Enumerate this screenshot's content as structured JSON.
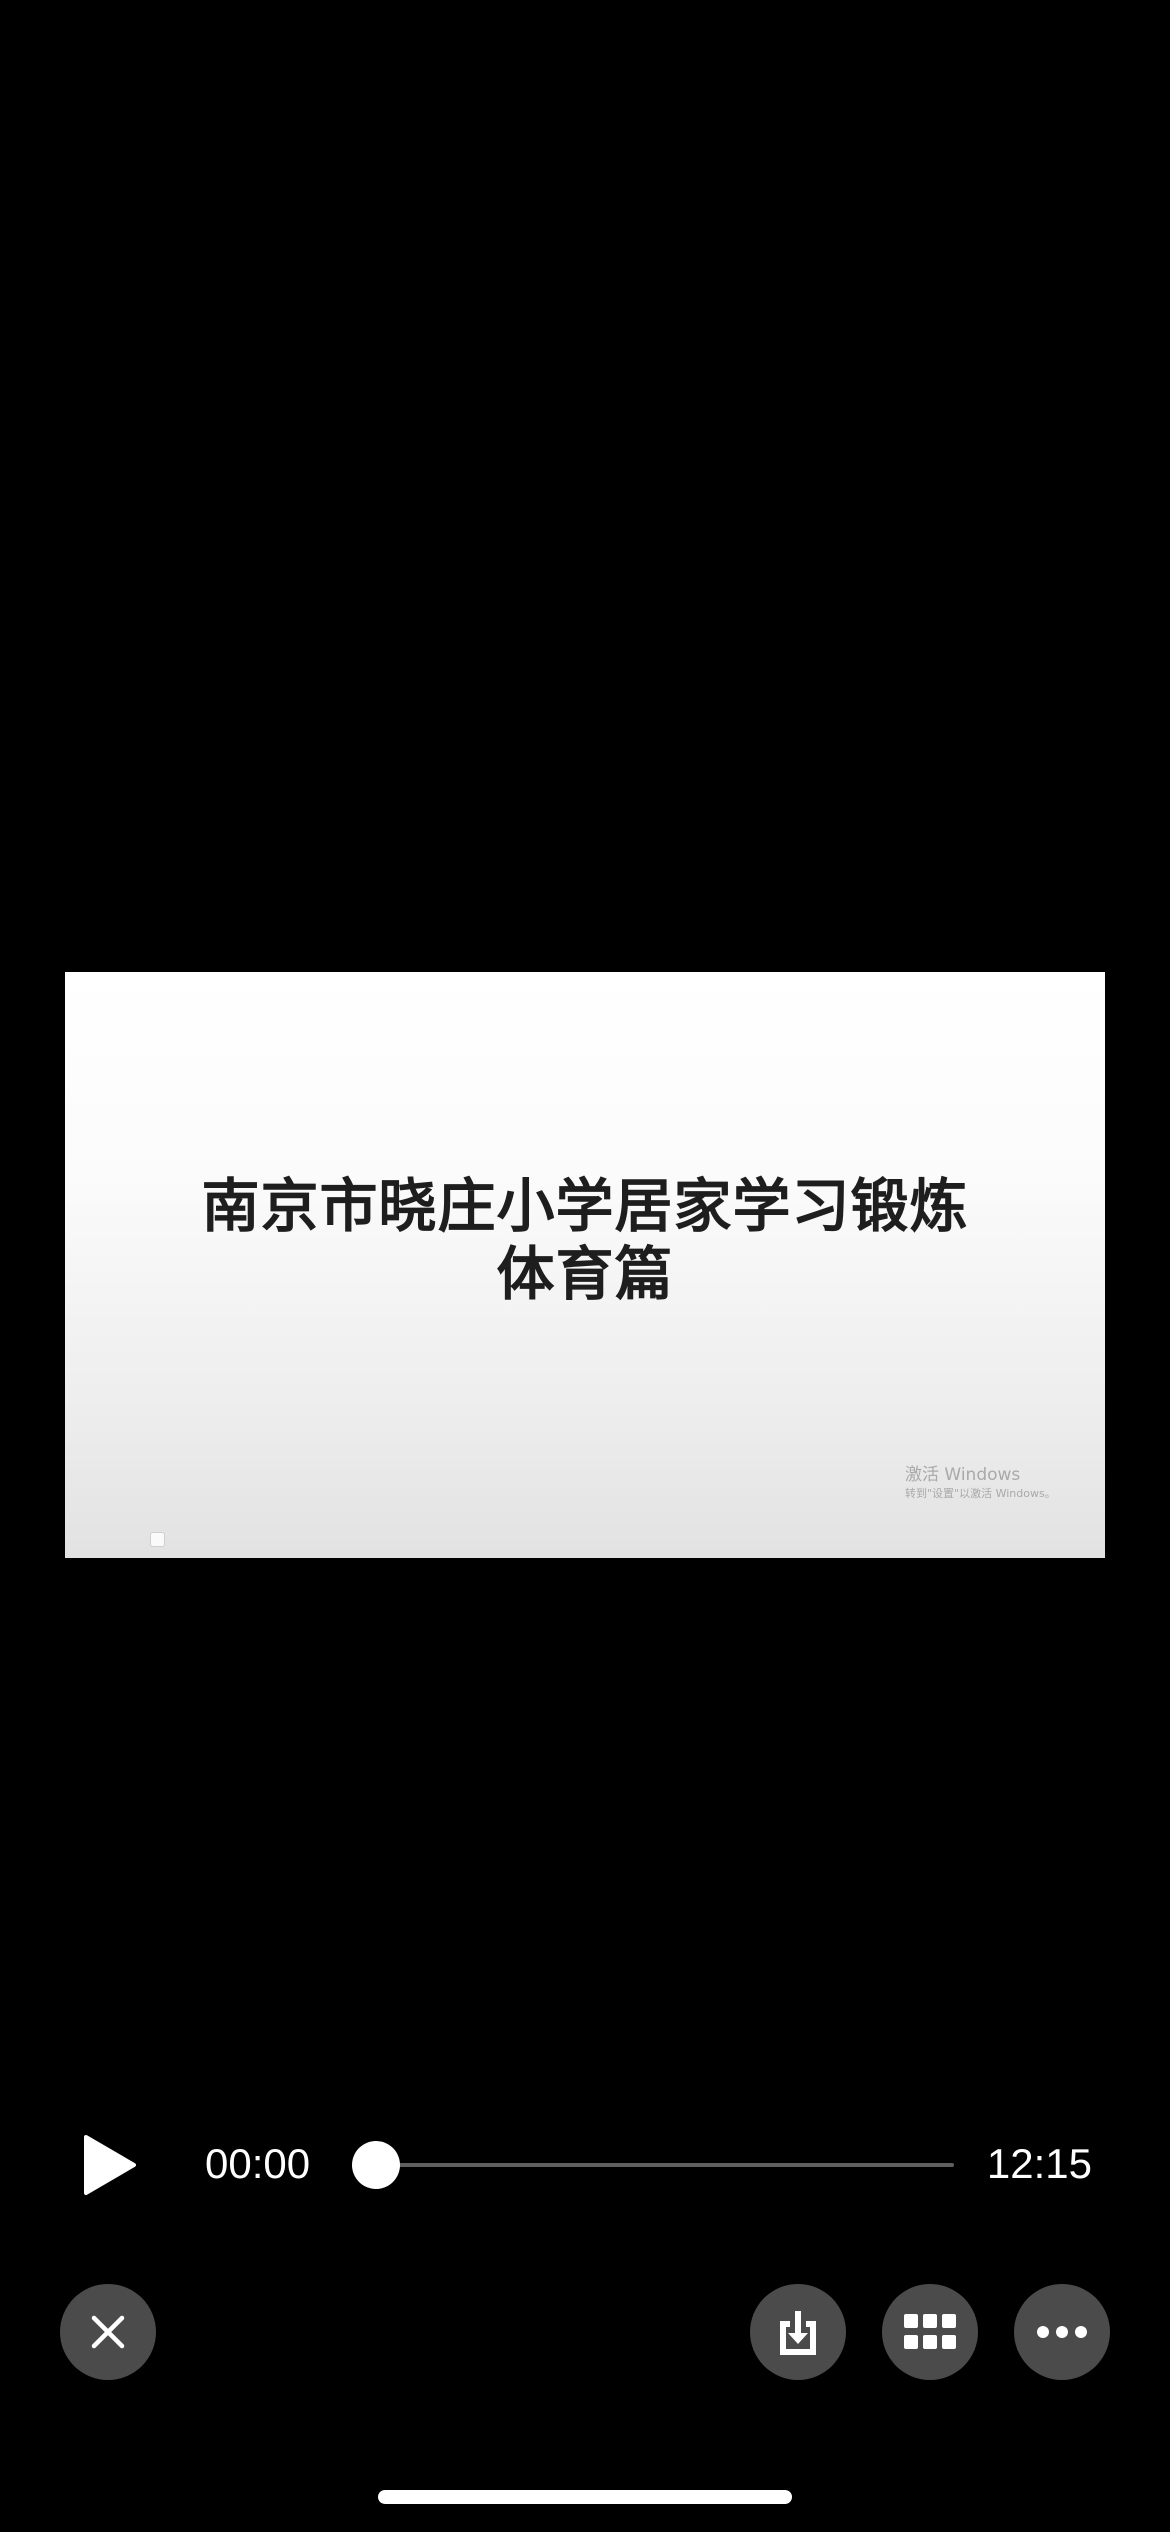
{
  "video": {
    "slide_title_line1": "南京市晓庄小学居家学习锻炼",
    "slide_title_line2": "体育篇",
    "watermark_line1": "激活 Windows",
    "watermark_line2": "转到\"设置\"以激活 Windows。"
  },
  "playback": {
    "state": "paused",
    "elapsed": "00:00",
    "duration": "12:15",
    "progress": 0.0
  },
  "controls": {
    "play_icon": "play-icon",
    "close_icon": "close-icon",
    "save_icon": "download-to-device-icon",
    "grid_icon": "grid-icon",
    "more_icon": "more-horizontal-icon"
  },
  "colors": {
    "background": "#000000",
    "button_fill": "#4b4b4b",
    "track": "#5f5f5f",
    "foreground": "#ffffff"
  }
}
